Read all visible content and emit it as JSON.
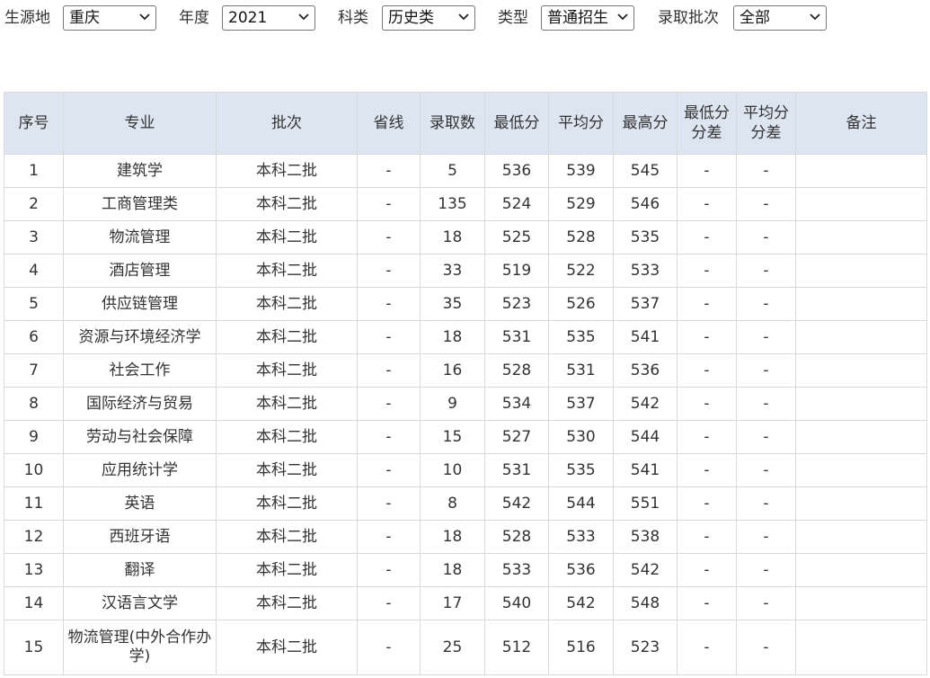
{
  "filters": [
    {
      "label": "生源地",
      "value": "重庆",
      "name": "province"
    },
    {
      "label": "年度",
      "value": "2021",
      "name": "year"
    },
    {
      "label": "科类",
      "value": "历史类",
      "name": "subject"
    },
    {
      "label": "类型",
      "value": "普通招生",
      "name": "type"
    },
    {
      "label": "录取批次",
      "value": "全部",
      "name": "batch"
    }
  ],
  "table": {
    "headers": [
      "序号",
      "专业",
      "批次",
      "省线",
      "录取数",
      "最低分",
      "平均分",
      "最高分",
      "最低分分差",
      "平均分分差",
      "备注"
    ],
    "rows": [
      [
        "1",
        "建筑学",
        "本科二批",
        "-",
        "5",
        "536",
        "539",
        "545",
        "-",
        "-",
        ""
      ],
      [
        "2",
        "工商管理类",
        "本科二批",
        "-",
        "135",
        "524",
        "529",
        "546",
        "-",
        "-",
        ""
      ],
      [
        "3",
        "物流管理",
        "本科二批",
        "-",
        "18",
        "525",
        "528",
        "535",
        "-",
        "-",
        ""
      ],
      [
        "4",
        "酒店管理",
        "本科二批",
        "-",
        "33",
        "519",
        "522",
        "533",
        "-",
        "-",
        ""
      ],
      [
        "5",
        "供应链管理",
        "本科二批",
        "-",
        "35",
        "523",
        "526",
        "537",
        "-",
        "-",
        ""
      ],
      [
        "6",
        "资源与环境经济学",
        "本科二批",
        "-",
        "18",
        "531",
        "535",
        "541",
        "-",
        "-",
        ""
      ],
      [
        "7",
        "社会工作",
        "本科二批",
        "-",
        "16",
        "528",
        "531",
        "536",
        "-",
        "-",
        ""
      ],
      [
        "8",
        "国际经济与贸易",
        "本科二批",
        "-",
        "9",
        "534",
        "537",
        "542",
        "-",
        "-",
        ""
      ],
      [
        "9",
        "劳动与社会保障",
        "本科二批",
        "-",
        "15",
        "527",
        "530",
        "544",
        "-",
        "-",
        ""
      ],
      [
        "10",
        "应用统计学",
        "本科二批",
        "-",
        "10",
        "531",
        "535",
        "541",
        "-",
        "-",
        ""
      ],
      [
        "11",
        "英语",
        "本科二批",
        "-",
        "8",
        "542",
        "544",
        "551",
        "-",
        "-",
        ""
      ],
      [
        "12",
        "西班牙语",
        "本科二批",
        "-",
        "18",
        "528",
        "533",
        "538",
        "-",
        "-",
        ""
      ],
      [
        "13",
        "翻译",
        "本科二批",
        "-",
        "18",
        "533",
        "536",
        "542",
        "-",
        "-",
        ""
      ],
      [
        "14",
        "汉语言文学",
        "本科二批",
        "-",
        "17",
        "540",
        "542",
        "548",
        "-",
        "-",
        ""
      ],
      [
        "15",
        "物流管理(中外合作办学)",
        "本科二批",
        "-",
        "25",
        "512",
        "516",
        "523",
        "-",
        "-",
        ""
      ]
    ]
  }
}
